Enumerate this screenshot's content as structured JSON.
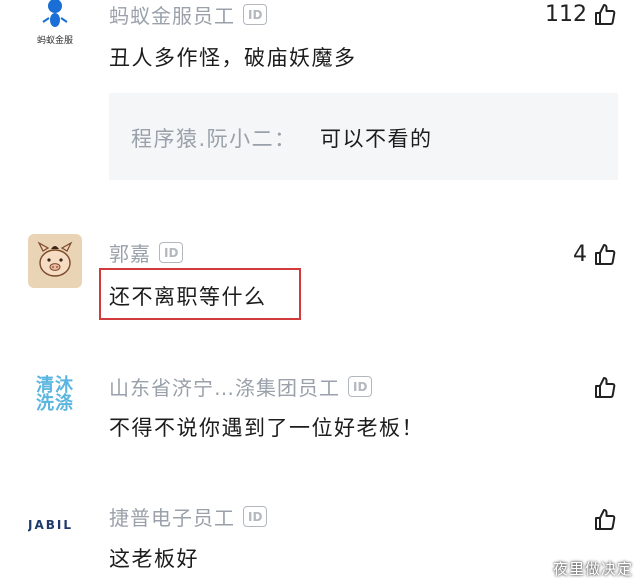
{
  "comments": [
    {
      "avatar_label": "蚂蚁金服",
      "name": "蚂蚁金服员工",
      "id_badge": "ID",
      "text": "丑人多作怪，破庙妖魔多",
      "like_count": "112",
      "reply": {
        "name": "程序猿.阮小二：",
        "text": "可以不看的"
      }
    },
    {
      "name": "郭嘉",
      "id_badge": "ID",
      "text": "还不离职等什么",
      "like_count": "4"
    },
    {
      "avatar_label": "清沐洗涤",
      "name": "山东省济宁…涤集团员工",
      "id_badge": "ID",
      "text": "不得不说你遇到了一位好老板！",
      "like_count": ""
    },
    {
      "avatar_label": "JABIL",
      "name": "捷普电子员工",
      "id_badge": "ID",
      "text": "这老板好",
      "like_count": ""
    }
  ],
  "watermark": "夜里做决定",
  "colors": {
    "highlight_border": "#d23b3b",
    "name_gray": "#9aa1aa",
    "qingmu_blue": "#5ab5e0",
    "jabil_navy": "#1e3a6b"
  }
}
